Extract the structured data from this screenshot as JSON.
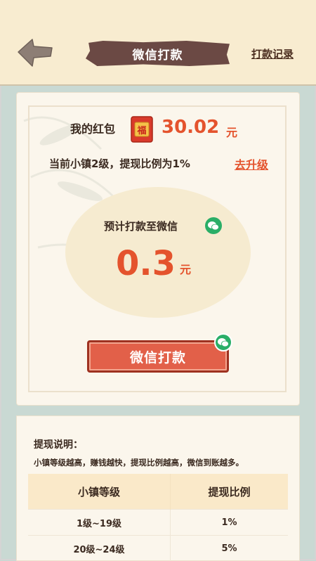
{
  "header": {
    "title": "微信打款",
    "record_link": "打款记录"
  },
  "wallet": {
    "label": "我的红包",
    "amount": "30.02",
    "unit": "元",
    "hongbao_char": "福"
  },
  "level": {
    "text": "当前小镇2级，提现比例为1%",
    "upgrade_link": "去升级"
  },
  "estimate": {
    "label": "预计打款至微信",
    "amount": "0.3",
    "unit": "元"
  },
  "action": {
    "button_label": "微信打款"
  },
  "instructions": {
    "title": "提现说明：",
    "description": "小镇等级越高，赚钱越快，提现比例越高，微信到账越多。",
    "table": {
      "headers": [
        "小镇等级",
        "提现比例"
      ],
      "rows": [
        [
          "1级~19级",
          "1%"
        ],
        [
          "20级~24级",
          "5%"
        ]
      ]
    }
  },
  "colors": {
    "accent": "#e4532d",
    "header_bg": "#f8ecd0",
    "title_band": "#6b4944",
    "button": "#e26049",
    "wechat_green": "#2aae67"
  }
}
